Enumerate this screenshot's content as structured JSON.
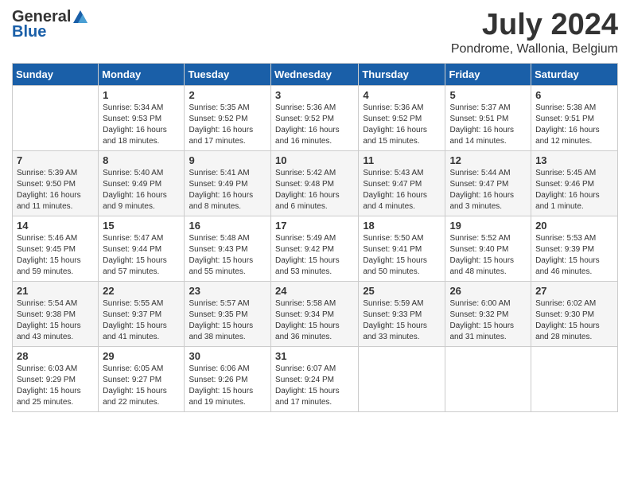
{
  "header": {
    "logo_general": "General",
    "logo_blue": "Blue",
    "title": "July 2024",
    "location": "Pondrome, Wallonia, Belgium"
  },
  "weekdays": [
    "Sunday",
    "Monday",
    "Tuesday",
    "Wednesday",
    "Thursday",
    "Friday",
    "Saturday"
  ],
  "weeks": [
    [
      {
        "day": "",
        "info": ""
      },
      {
        "day": "1",
        "info": "Sunrise: 5:34 AM\nSunset: 9:53 PM\nDaylight: 16 hours\nand 18 minutes."
      },
      {
        "day": "2",
        "info": "Sunrise: 5:35 AM\nSunset: 9:52 PM\nDaylight: 16 hours\nand 17 minutes."
      },
      {
        "day": "3",
        "info": "Sunrise: 5:36 AM\nSunset: 9:52 PM\nDaylight: 16 hours\nand 16 minutes."
      },
      {
        "day": "4",
        "info": "Sunrise: 5:36 AM\nSunset: 9:52 PM\nDaylight: 16 hours\nand 15 minutes."
      },
      {
        "day": "5",
        "info": "Sunrise: 5:37 AM\nSunset: 9:51 PM\nDaylight: 16 hours\nand 14 minutes."
      },
      {
        "day": "6",
        "info": "Sunrise: 5:38 AM\nSunset: 9:51 PM\nDaylight: 16 hours\nand 12 minutes."
      }
    ],
    [
      {
        "day": "7",
        "info": "Sunrise: 5:39 AM\nSunset: 9:50 PM\nDaylight: 16 hours\nand 11 minutes."
      },
      {
        "day": "8",
        "info": "Sunrise: 5:40 AM\nSunset: 9:49 PM\nDaylight: 16 hours\nand 9 minutes."
      },
      {
        "day": "9",
        "info": "Sunrise: 5:41 AM\nSunset: 9:49 PM\nDaylight: 16 hours\nand 8 minutes."
      },
      {
        "day": "10",
        "info": "Sunrise: 5:42 AM\nSunset: 9:48 PM\nDaylight: 16 hours\nand 6 minutes."
      },
      {
        "day": "11",
        "info": "Sunrise: 5:43 AM\nSunset: 9:47 PM\nDaylight: 16 hours\nand 4 minutes."
      },
      {
        "day": "12",
        "info": "Sunrise: 5:44 AM\nSunset: 9:47 PM\nDaylight: 16 hours\nand 3 minutes."
      },
      {
        "day": "13",
        "info": "Sunrise: 5:45 AM\nSunset: 9:46 PM\nDaylight: 16 hours\nand 1 minute."
      }
    ],
    [
      {
        "day": "14",
        "info": "Sunrise: 5:46 AM\nSunset: 9:45 PM\nDaylight: 15 hours\nand 59 minutes."
      },
      {
        "day": "15",
        "info": "Sunrise: 5:47 AM\nSunset: 9:44 PM\nDaylight: 15 hours\nand 57 minutes."
      },
      {
        "day": "16",
        "info": "Sunrise: 5:48 AM\nSunset: 9:43 PM\nDaylight: 15 hours\nand 55 minutes."
      },
      {
        "day": "17",
        "info": "Sunrise: 5:49 AM\nSunset: 9:42 PM\nDaylight: 15 hours\nand 53 minutes."
      },
      {
        "day": "18",
        "info": "Sunrise: 5:50 AM\nSunset: 9:41 PM\nDaylight: 15 hours\nand 50 minutes."
      },
      {
        "day": "19",
        "info": "Sunrise: 5:52 AM\nSunset: 9:40 PM\nDaylight: 15 hours\nand 48 minutes."
      },
      {
        "day": "20",
        "info": "Sunrise: 5:53 AM\nSunset: 9:39 PM\nDaylight: 15 hours\nand 46 minutes."
      }
    ],
    [
      {
        "day": "21",
        "info": "Sunrise: 5:54 AM\nSunset: 9:38 PM\nDaylight: 15 hours\nand 43 minutes."
      },
      {
        "day": "22",
        "info": "Sunrise: 5:55 AM\nSunset: 9:37 PM\nDaylight: 15 hours\nand 41 minutes."
      },
      {
        "day": "23",
        "info": "Sunrise: 5:57 AM\nSunset: 9:35 PM\nDaylight: 15 hours\nand 38 minutes."
      },
      {
        "day": "24",
        "info": "Sunrise: 5:58 AM\nSunset: 9:34 PM\nDaylight: 15 hours\nand 36 minutes."
      },
      {
        "day": "25",
        "info": "Sunrise: 5:59 AM\nSunset: 9:33 PM\nDaylight: 15 hours\nand 33 minutes."
      },
      {
        "day": "26",
        "info": "Sunrise: 6:00 AM\nSunset: 9:32 PM\nDaylight: 15 hours\nand 31 minutes."
      },
      {
        "day": "27",
        "info": "Sunrise: 6:02 AM\nSunset: 9:30 PM\nDaylight: 15 hours\nand 28 minutes."
      }
    ],
    [
      {
        "day": "28",
        "info": "Sunrise: 6:03 AM\nSunset: 9:29 PM\nDaylight: 15 hours\nand 25 minutes."
      },
      {
        "day": "29",
        "info": "Sunrise: 6:05 AM\nSunset: 9:27 PM\nDaylight: 15 hours\nand 22 minutes."
      },
      {
        "day": "30",
        "info": "Sunrise: 6:06 AM\nSunset: 9:26 PM\nDaylight: 15 hours\nand 19 minutes."
      },
      {
        "day": "31",
        "info": "Sunrise: 6:07 AM\nSunset: 9:24 PM\nDaylight: 15 hours\nand 17 minutes."
      },
      {
        "day": "",
        "info": ""
      },
      {
        "day": "",
        "info": ""
      },
      {
        "day": "",
        "info": ""
      }
    ]
  ]
}
